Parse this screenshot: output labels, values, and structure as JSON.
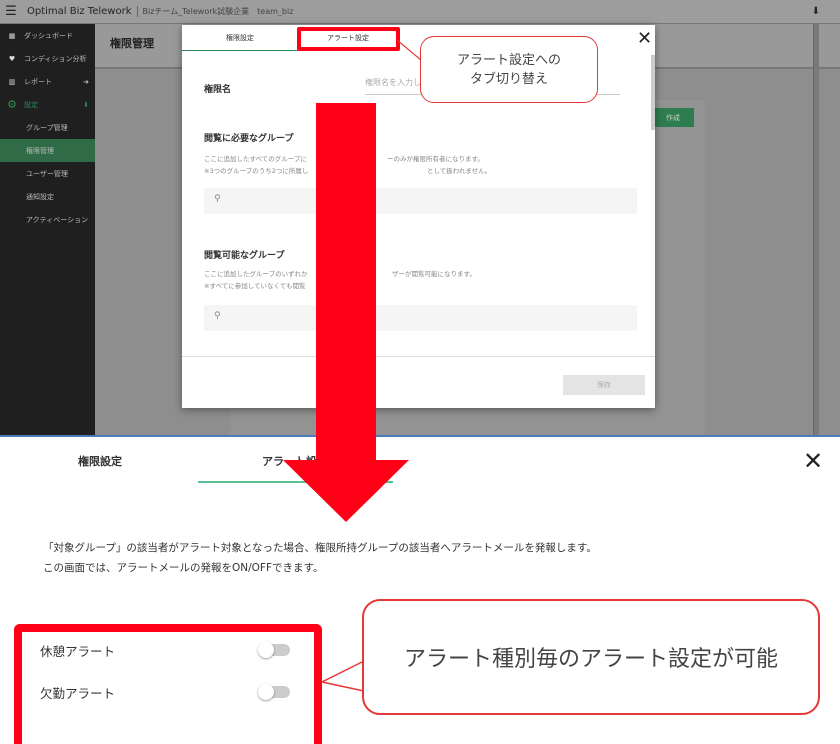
{
  "app": {
    "menu_icon": "hamburger-icon",
    "title": "Optimal Biz Telework",
    "org": "Bizチーム_Telework試験企業",
    "user": "team_biz",
    "user_icon": "download-icon"
  },
  "sidebar": {
    "items": [
      {
        "label": "ダッシュボード",
        "icon": "dashboard-icon"
      },
      {
        "label": "コンディション分析",
        "icon": "heart-icon"
      },
      {
        "label": "レポート",
        "icon": "chart-icon"
      },
      {
        "label": "設定",
        "icon": "gear-icon"
      },
      {
        "label": "グループ管理"
      },
      {
        "label": "権限管理"
      },
      {
        "label": "ユーザー管理"
      },
      {
        "label": "通知設定"
      },
      {
        "label": "アクティベーション"
      }
    ]
  },
  "page": {
    "title": "権限管理",
    "create_button": "作成"
  },
  "modal": {
    "tabs": [
      "権限設定",
      "アラート設定"
    ],
    "name_label": "権限名",
    "name_placeholder": "権限名を入力し",
    "required_title": "閲覧に必要なグループ",
    "required_help": [
      "ここに追加したすべてのグループに",
      "ーのみが権限所有者になります。",
      "※3つのグループのうち2つに所属し",
      "として扱われません。"
    ],
    "viewable_title": "閲覧可能なグループ",
    "viewable_help": [
      "ここに追加したグループのいずれか",
      "ザーが閲覧可能になります。",
      "※すべてに参加していなくても閲覧"
    ],
    "save": "保存"
  },
  "callout_top": "アラート設定への\nタブ切り替え",
  "alert_panel": {
    "tabs": [
      "権限設定",
      "アラート設"
    ],
    "description": [
      "「対象グループ」の該当者がアラート対象となった場合、権限所持グループの該当者へアラートメールを発報します。",
      "この画面では、アラートメールの発報をON/OFFできます。"
    ],
    "toggles": [
      {
        "label": "休憩アラート",
        "on": false
      },
      {
        "label": "欠勤アラート",
        "on": false
      }
    ]
  },
  "callout_bottom": "アラート種別毎のアラート設定が可能",
  "colors": {
    "annotation_red": "#ff0016",
    "accent_green": "#2e8b57"
  }
}
